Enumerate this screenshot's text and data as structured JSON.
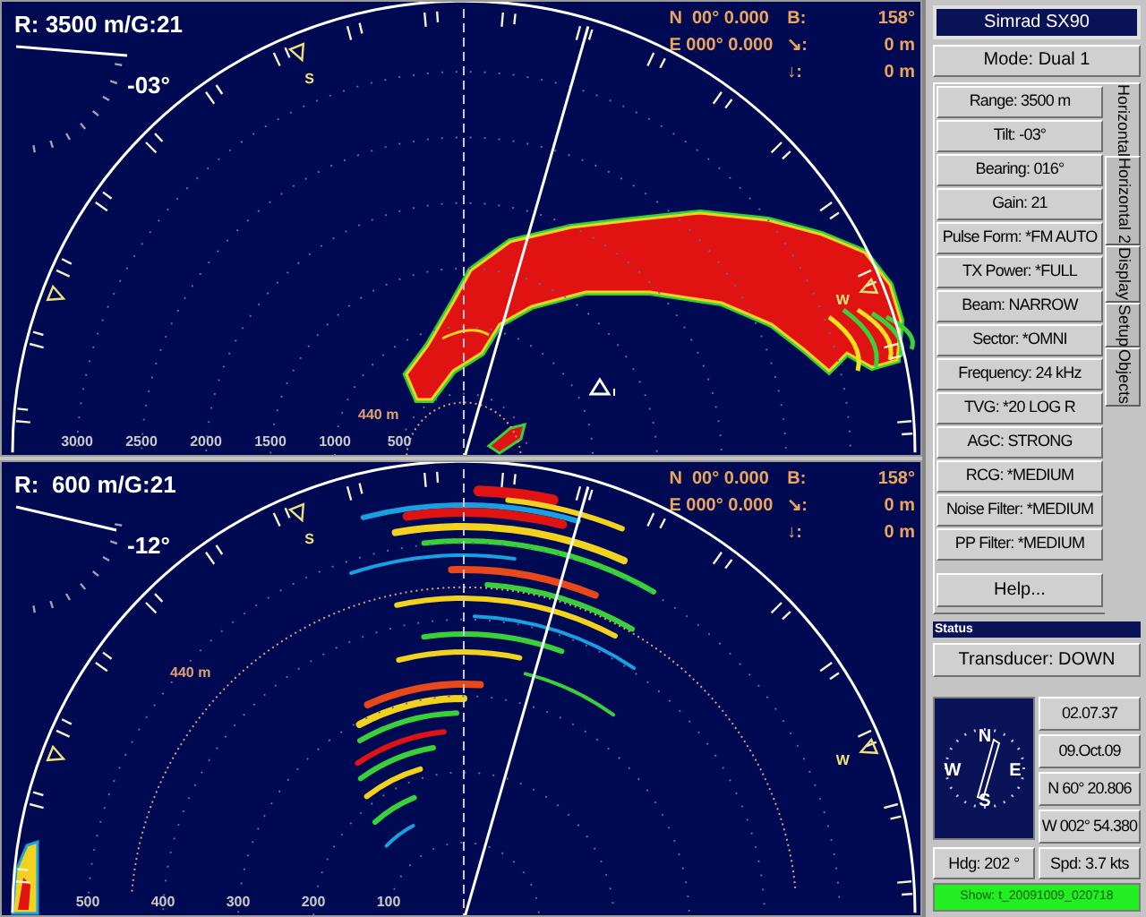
{
  "displays": [
    {
      "range_gain": "R: 3500 m/G:21",
      "tilt": "-03°",
      "bearing_marks": [
        {
          "label": "S"
        },
        {
          "label": "W"
        }
      ],
      "ring_label": "440 m",
      "scale_labels": [
        "3000",
        "2500",
        "2000",
        "1500",
        "1000",
        "500"
      ],
      "position": [
        "N  00° 0.000",
        "E 000° 0.000"
      ],
      "readouts": [
        {
          "label": "B:",
          "value": "158°"
        },
        {
          "label": "↘:",
          "value": "0 m"
        },
        {
          "label": "↓:",
          "value": "0 m"
        }
      ]
    },
    {
      "range_gain": "R:  600 m/G:21",
      "tilt": "-12°",
      "bearing_marks": [
        {
          "label": "S"
        },
        {
          "label": "W"
        }
      ],
      "ring_label": "440 m",
      "scale_labels": [
        "500",
        "400",
        "300",
        "200",
        "100"
      ],
      "position": [
        "N  00° 0.000",
        "E 000° 0.000"
      ],
      "readouts": [
        {
          "label": "B:",
          "value": "158°"
        },
        {
          "label": "↘:",
          "value": "0 m"
        },
        {
          "label": "↓:",
          "value": "0 m"
        }
      ]
    }
  ],
  "sidebar": {
    "title": "Simrad SX90",
    "mode": "Mode: Dual 1",
    "controls": [
      "Range: 3500 m",
      "Tilt: -03°",
      "Bearing: 016°",
      "Gain: 21",
      "Pulse Form: *FM AUTO",
      "TX Power: *FULL",
      "Beam: NARROW",
      "Sector: *OMNI",
      "Frequency: 24 kHz",
      "TVG: *20 LOG R",
      "AGC: STRONG",
      "RCG: *MEDIUM",
      "Noise Filter: *MEDIUM",
      "PP Filter: *MEDIUM"
    ],
    "help": "Help...",
    "tabs": [
      {
        "label": "Horizontal",
        "selected": true
      },
      {
        "label": "Horizontal 2",
        "selected": false
      },
      {
        "label": "Display",
        "selected": false
      },
      {
        "label": "Setup",
        "selected": false
      },
      {
        "label": "Objects",
        "selected": false
      }
    ],
    "status": {
      "title": "Status",
      "transducer": "Transducer: DOWN",
      "compass_labels": [
        "N",
        "E",
        "S",
        "W"
      ],
      "time": "02.07.37",
      "date": "09.Oct.09",
      "latitude": "N 60° 20.806",
      "longitude": "W 002° 54.380",
      "heading": "Hdg: 202 °",
      "speed": "Spd: 3.7 kts",
      "show_file": "Show: t_20091009_020718"
    }
  }
}
